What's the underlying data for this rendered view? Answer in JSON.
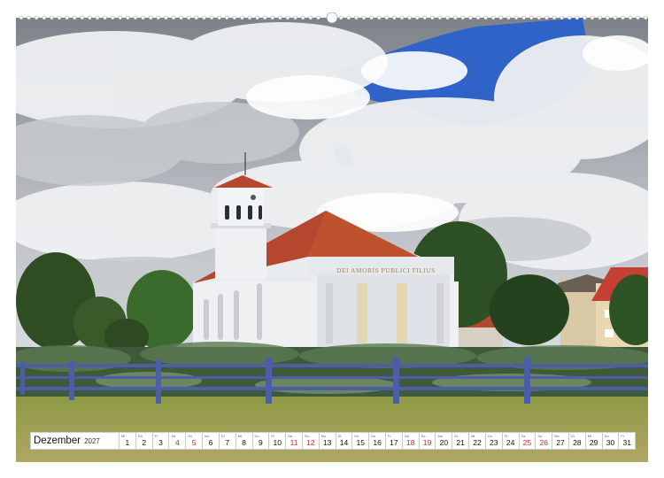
{
  "calendar": {
    "month": "Dezember",
    "year": "2027",
    "days": [
      {
        "num": "1",
        "wd": "Mi",
        "red": false
      },
      {
        "num": "2",
        "wd": "Do",
        "red": false
      },
      {
        "num": "3",
        "wd": "Fr",
        "red": false
      },
      {
        "num": "4",
        "wd": "Sa",
        "red": true
      },
      {
        "num": "5",
        "wd": "So",
        "red": true
      },
      {
        "num": "6",
        "wd": "Mo",
        "red": false
      },
      {
        "num": "7",
        "wd": "Di",
        "red": false
      },
      {
        "num": "8",
        "wd": "Mi",
        "red": false
      },
      {
        "num": "9",
        "wd": "Do",
        "red": false
      },
      {
        "num": "10",
        "wd": "Fr",
        "red": false
      },
      {
        "num": "11",
        "wd": "Sa",
        "red": true
      },
      {
        "num": "12",
        "wd": "So",
        "red": true
      },
      {
        "num": "13",
        "wd": "Mo",
        "red": false
      },
      {
        "num": "14",
        "wd": "Di",
        "red": false
      },
      {
        "num": "15",
        "wd": "Mi",
        "red": false
      },
      {
        "num": "16",
        "wd": "Do",
        "red": false
      },
      {
        "num": "17",
        "wd": "Fr",
        "red": false
      },
      {
        "num": "18",
        "wd": "Sa",
        "red": true
      },
      {
        "num": "19",
        "wd": "So",
        "red": true
      },
      {
        "num": "20",
        "wd": "Mo",
        "red": false
      },
      {
        "num": "21",
        "wd": "Di",
        "red": false
      },
      {
        "num": "22",
        "wd": "Mi",
        "red": false
      },
      {
        "num": "23",
        "wd": "Do",
        "red": false
      },
      {
        "num": "24",
        "wd": "Fr",
        "red": false
      },
      {
        "num": "25",
        "wd": "Sa",
        "red": true
      },
      {
        "num": "26",
        "wd": "So",
        "red": true
      },
      {
        "num": "27",
        "wd": "Mo",
        "red": false
      },
      {
        "num": "28",
        "wd": "Di",
        "red": false
      },
      {
        "num": "29",
        "wd": "Mi",
        "red": false
      },
      {
        "num": "30",
        "wd": "Do",
        "red": false
      },
      {
        "num": "31",
        "wd": "Fr",
        "red": false
      }
    ]
  },
  "building": {
    "inscription": "DEI AMORIS PUBLICI FILIUS"
  },
  "colors": {
    "sky_blue": "#2f63c8",
    "roof": "#b5472e",
    "fence": "#4a5fa8",
    "grass": "#8a9a3e",
    "weekend": "#c0282d"
  }
}
